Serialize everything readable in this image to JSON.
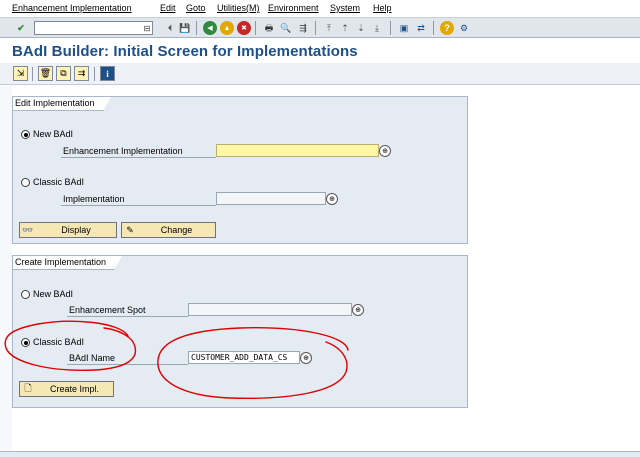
{
  "menu": {
    "items": [
      {
        "label": "Enhancement Implementation"
      },
      {
        "label": "Edit"
      },
      {
        "label": "Goto"
      },
      {
        "label": "Utilities(M)"
      },
      {
        "label": "Environment"
      },
      {
        "label": "System"
      },
      {
        "label": "Help"
      }
    ]
  },
  "toolbar": {
    "command_value": "",
    "icons": {
      "enter": "✔",
      "dropdown": "⊟",
      "back_nav": "⏴",
      "save": "💾",
      "back": "◀",
      "exit": "▲",
      "cancel": "✖",
      "print": "🖶",
      "find": "🔍",
      "find_next": "⇶",
      "first_page": "⤒",
      "prev_page": "⇡",
      "next_page": "⇣",
      "last_page": "⤓",
      "new_session": "▣",
      "shortcut": "⇄",
      "help": "?",
      "layout": "⚙"
    }
  },
  "title": "BAdI Builder: Initial Screen for Implementations",
  "app_toolbar": {
    "icons": {
      "other_object": "⇲",
      "delete": "🗑",
      "copy": "⧉",
      "rename": "⇉",
      "info": "i"
    }
  },
  "edit_group": {
    "title": "Edit Implementation",
    "new_badi_label": "New BAdI",
    "enh_impl_label": "Enhancement Implementation",
    "enh_impl_value": "",
    "classic_badi_label": "Classic BAdI",
    "impl_label": "Implementation",
    "impl_value": "",
    "display_label": "Display",
    "change_label": "Change",
    "icons": {
      "display": "👓",
      "change": "✎",
      "f4": "⊕"
    }
  },
  "create_group": {
    "title": "Create Implementation",
    "new_badi_label": "New BAdI",
    "enh_spot_label": "Enhancement Spot",
    "enh_spot_value": "",
    "classic_badi_label": "Classic BAdI",
    "badi_name_label": "BAdI Name",
    "badi_name_value": "CUSTOMER_ADD_DATA_CS",
    "create_label": "Create Impl.",
    "icons": {
      "create": "🗋",
      "f4": "⊕"
    }
  },
  "annotation_color": "#e00000"
}
